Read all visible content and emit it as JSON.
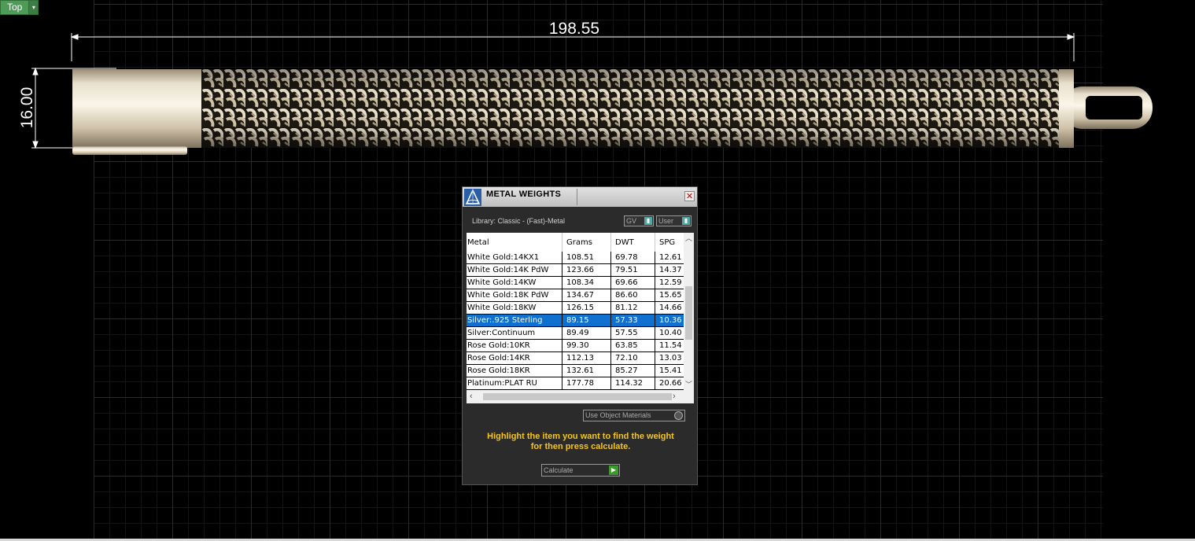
{
  "view": {
    "label": "Top",
    "dropdown": "▾"
  },
  "dimensions": {
    "length": "198.55",
    "height": "16.00"
  },
  "colors": {
    "metal": "#e6dcc8",
    "selection": "#1070cf",
    "hint": "#f5c518",
    "view_button": "#4e9a57"
  },
  "panel": {
    "title": "METAL WEIGHTS",
    "close": "✕",
    "library": "Library: Classic - (Fast)-Metal",
    "gv": "GV",
    "user": "User",
    "columns": [
      "Metal",
      "Grams",
      "DWT",
      "SPG"
    ],
    "rows": [
      {
        "metal": "White Gold:14KX1",
        "grams": "108.51",
        "dwt": "69.78",
        "spg": "12.61"
      },
      {
        "metal": "White Gold:14K PdW",
        "grams": "123.66",
        "dwt": "79.51",
        "spg": "14.37"
      },
      {
        "metal": "White Gold:14KW",
        "grams": "108.34",
        "dwt": "69.66",
        "spg": "12.59"
      },
      {
        "metal": "White Gold:18K PdW",
        "grams": "134.67",
        "dwt": "86.60",
        "spg": "15.65"
      },
      {
        "metal": "White Gold:18KW",
        "grams": "126.15",
        "dwt": "81.12",
        "spg": "14.66"
      },
      {
        "metal": "Silver:.925 Sterling",
        "grams": "89.15",
        "dwt": "57.33",
        "spg": "10.36"
      },
      {
        "metal": "Silver:Continuum",
        "grams": "89.49",
        "dwt": "57.55",
        "spg": "10.40"
      },
      {
        "metal": "Rose Gold:10KR",
        "grams": "99.30",
        "dwt": "63.85",
        "spg": "11.54"
      },
      {
        "metal": "Rose Gold:14KR",
        "grams": "112.13",
        "dwt": "72.10",
        "spg": "13.03"
      },
      {
        "metal": "Rose Gold:18KR",
        "grams": "132.61",
        "dwt": "85.27",
        "spg": "15.41"
      },
      {
        "metal": "Platinum:PLAT RU",
        "grams": "177.78",
        "dwt": "114.32",
        "spg": "20.66"
      }
    ],
    "selected_index": 5,
    "use_object_materials": "Use Object Materials",
    "hint_line1": "Highlight the item you want to find the weight",
    "hint_line2": "for then press calculate.",
    "calculate": "Calculate"
  }
}
